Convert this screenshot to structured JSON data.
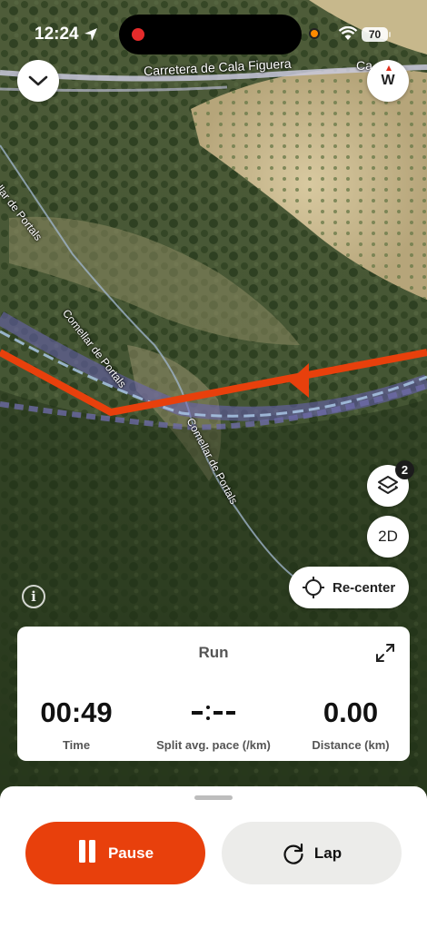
{
  "status_bar": {
    "time": "12:24",
    "battery": "70"
  },
  "map": {
    "street_labels": [
      "Carretera de Cala Figuera",
      "Ca",
      "Comellar de Portals",
      "Comellar de Portals",
      "ellar de Portals"
    ],
    "compass_heading": "W",
    "layers_badge": "2",
    "view_mode_label": "2D",
    "recenter_label": "Re-center",
    "info_label": "i",
    "colors": {
      "route": "#e8400c",
      "trail": "#7f73c9"
    }
  },
  "stats": {
    "activity_type": "Run",
    "time": {
      "value": "00:49",
      "label": "Time"
    },
    "pace": {
      "value": "-:--",
      "label": "Split avg. pace (/km)"
    },
    "distance": {
      "value": "0.00",
      "label": "Distance (km)"
    }
  },
  "controls": {
    "pause_label": "Pause",
    "lap_label": "Lap",
    "accent": "#e8400c"
  },
  "icons": [
    "location-arrow-icon",
    "record-icon",
    "wifi-icon",
    "chevron-down-icon",
    "compass-icon",
    "layers-icon",
    "crosshair-icon",
    "info-icon",
    "expand-icon",
    "pause-icon",
    "lap-icon"
  ]
}
